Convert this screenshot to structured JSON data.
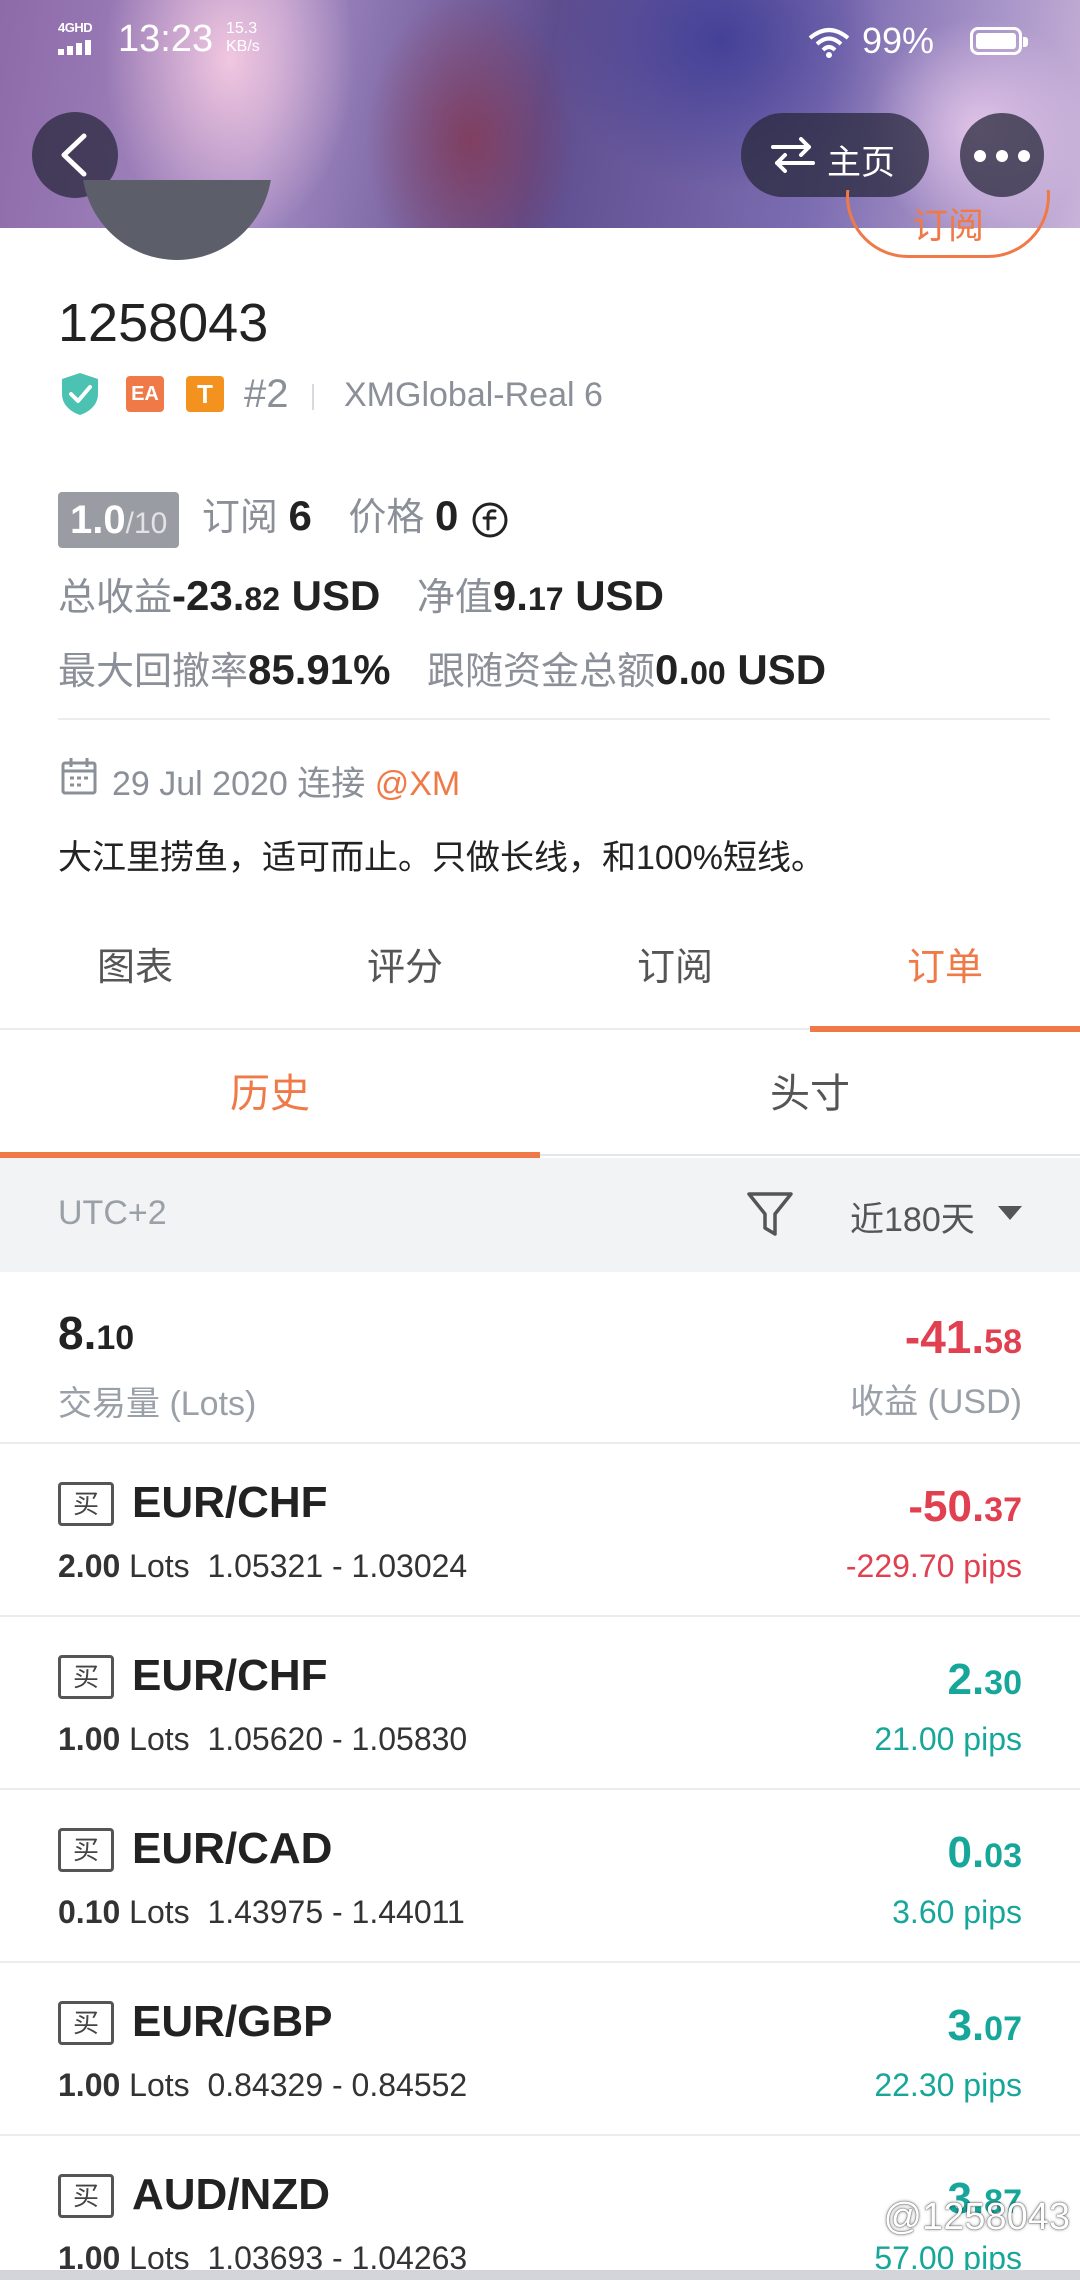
{
  "status_bar": {
    "network": "4GHD",
    "time": "13:23",
    "speed_value": "15.3",
    "speed_unit": "KB/s",
    "battery": "99%"
  },
  "header": {
    "back_icon": "chevron-left-icon",
    "home_label": "主页",
    "home_icon": "swap-arrows-icon",
    "more_icon": "more-dots-icon",
    "subscribe_label": "订阅"
  },
  "profile": {
    "account_id": "1258043",
    "rank": "#2",
    "server": "XMGlobal-Real 6",
    "badges": {
      "ea": "EA",
      "t": "T"
    },
    "rating": "1.0",
    "rating_max": "/10",
    "subscriptions_label": "订阅",
    "subscriptions": "6",
    "price_label": "价格",
    "price": "0",
    "total_profit_label": "总收益",
    "total_profit_int": "-23.",
    "total_profit_dec": "82",
    "total_profit_unit": "USD",
    "equity_label": "净值",
    "equity_int": "9.",
    "equity_dec": "17",
    "equity_unit": "USD",
    "max_drawdown_label": "最大回撤率",
    "max_drawdown": "85.91%",
    "follow_funds_label": "跟随资金总额",
    "follow_funds_int": "0.",
    "follow_funds_dec": "00",
    "follow_funds_unit": "USD",
    "join_date": "29 Jul 2020",
    "join_label": "连接",
    "broker_link": "@XM",
    "bio": "大江里捞鱼，适可而止。只做长线，和100%短线。"
  },
  "tabs": [
    "图表",
    "评分",
    "订阅",
    "订单"
  ],
  "active_tab": "订单",
  "sub_tabs": [
    "历史",
    "头寸"
  ],
  "active_sub_tab": "历史",
  "filter": {
    "timezone": "UTC+2",
    "range": "近180天"
  },
  "summary": {
    "volume_int": "8.",
    "volume_dec": "10",
    "volume_label": "交易量 (Lots)",
    "profit_int": "-41.",
    "profit_dec": "58",
    "profit_label": "收益 (USD)"
  },
  "orders": [
    {
      "side": "买",
      "symbol": "EUR/CHF",
      "lots": "2.00",
      "lots_unit": "Lots",
      "range": "1.05321 - 1.03024",
      "profit_int": "-50.",
      "profit_dec": "37",
      "pips": "-229.70 pips",
      "sign": "neg"
    },
    {
      "side": "买",
      "symbol": "EUR/CHF",
      "lots": "1.00",
      "lots_unit": "Lots",
      "range": "1.05620 - 1.05830",
      "profit_int": "2.",
      "profit_dec": "30",
      "pips": "21.00 pips",
      "sign": "pos"
    },
    {
      "side": "买",
      "symbol": "EUR/CAD",
      "lots": "0.10",
      "lots_unit": "Lots",
      "range": "1.43975 - 1.44011",
      "profit_int": "0.",
      "profit_dec": "03",
      "pips": "3.60 pips",
      "sign": "pos"
    },
    {
      "side": "买",
      "symbol": "EUR/GBP",
      "lots": "1.00",
      "lots_unit": "Lots",
      "range": "0.84329 - 0.84552",
      "profit_int": "3.",
      "profit_dec": "07",
      "pips": "22.30 pips",
      "sign": "pos"
    },
    {
      "side": "买",
      "symbol": "AUD/NZD",
      "lots": "1.00",
      "lots_unit": "Lots",
      "range": "1.03693 - 1.04263",
      "profit_int": "3.",
      "profit_dec": "87",
      "pips": "57.00 pips",
      "sign": "pos"
    }
  ],
  "watermark": "@1258043",
  "colors": {
    "accent": "#f07a47",
    "positive": "#17a79a",
    "negative": "#e0404f"
  }
}
